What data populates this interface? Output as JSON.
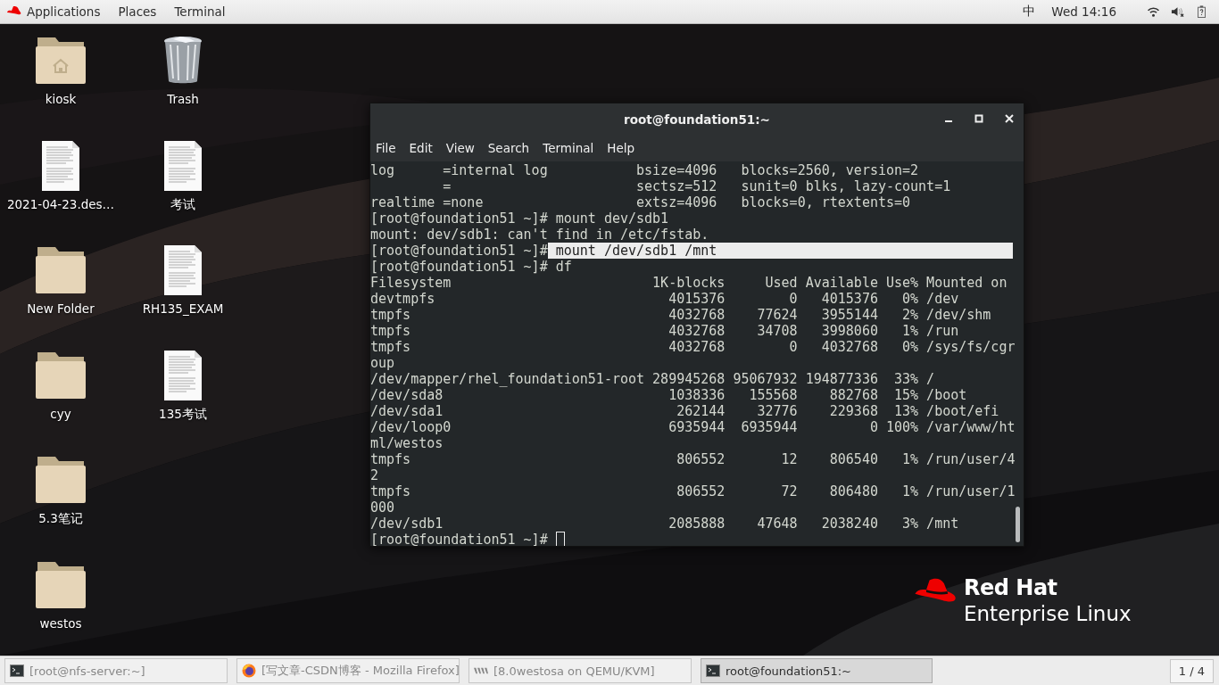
{
  "top_bar": {
    "menus": [
      "Applications",
      "Places",
      "Terminal"
    ],
    "input_method": "中",
    "clock": "Wed 14:16"
  },
  "desktop_icons": [
    {
      "label": "kiosk",
      "kind": "home-folder"
    },
    {
      "label": "2021-04-23.des…",
      "kind": "document"
    },
    {
      "label": "New Folder",
      "kind": "folder"
    },
    {
      "label": "cyy",
      "kind": "folder"
    },
    {
      "label": "5.3笔记",
      "kind": "folder"
    },
    {
      "label": "westos",
      "kind": "folder"
    },
    {
      "label": "Trash",
      "kind": "trash"
    },
    {
      "label": "考试",
      "kind": "document"
    },
    {
      "label": "RH135_EXAM",
      "kind": "document"
    },
    {
      "label": "135考试",
      "kind": "document"
    }
  ],
  "terminal": {
    "title": "root@foundation51:~",
    "menu": [
      "File",
      "Edit",
      "View",
      "Search",
      "Terminal",
      "Help"
    ],
    "lines": [
      {
        "text": "log      =internal log           bsize=4096   blocks=2560, version=2"
      },
      {
        "text": "         =                       sectsz=512   sunit=0 blks, lazy-count=1"
      },
      {
        "text": "realtime =none                   extsz=4096   blocks=0, rtextents=0"
      },
      {
        "text": "[root@foundation51 ~]# mount dev/sdb1"
      },
      {
        "text": "mount: dev/sdb1: can't find in /etc/fstab."
      },
      {
        "text": "[root@foundation51 ~]#",
        "selection": " mount /dev/sdb1 /mnt"
      },
      {
        "text": "[root@foundation51 ~]# df"
      },
      {
        "text": "Filesystem                         1K-blocks     Used Available Use% Mounted on"
      },
      {
        "text": "devtmpfs                             4015376        0   4015376   0% /dev"
      },
      {
        "text": "tmpfs                                4032768    77624   3955144   2% /dev/shm"
      },
      {
        "text": "tmpfs                                4032768    34708   3998060   1% /run"
      },
      {
        "text": "tmpfs                                4032768        0   4032768   0% /sys/fs/cgr"
      },
      {
        "text": "oup"
      },
      {
        "text": "/dev/mapper/rhel_foundation51-root 289945268 95067932 194877336  33% /"
      },
      {
        "text": "/dev/sda8                            1038336   155568    882768  15% /boot"
      },
      {
        "text": "/dev/sda1                             262144    32776    229368  13% /boot/efi"
      },
      {
        "text": "/dev/loop0                           6935944  6935944         0 100% /var/www/ht"
      },
      {
        "text": "ml/westos"
      },
      {
        "text": "tmpfs                                 806552       12    806540   1% /run/user/4"
      },
      {
        "text": "2"
      },
      {
        "text": "tmpfs                                 806552       72    806480   1% /run/user/1"
      },
      {
        "text": "000"
      },
      {
        "text": "/dev/sdb1                            2085888    47648   2038240   3% /mnt"
      },
      {
        "text": "[root@foundation51 ~]#",
        "cursor": true
      }
    ]
  },
  "wallpaper_logo": {
    "brand": "Red Hat",
    "product": "Enterprise Linux"
  },
  "taskbar": {
    "windows": [
      {
        "title": "[root@nfs-server:~]",
        "kind": "terminal",
        "minimized": true,
        "selected": false
      },
      {
        "title": "[写文章-CSDN博客 - Mozilla Firefox]",
        "kind": "firefox",
        "minimized": true,
        "selected": false
      },
      {
        "title": "[8.0westosa on QEMU/KVM]",
        "kind": "vm",
        "minimized": true,
        "selected": false
      },
      {
        "title": "root@foundation51:~",
        "kind": "terminal",
        "minimized": false,
        "selected": true
      }
    ],
    "workspace": "1 / 4"
  }
}
